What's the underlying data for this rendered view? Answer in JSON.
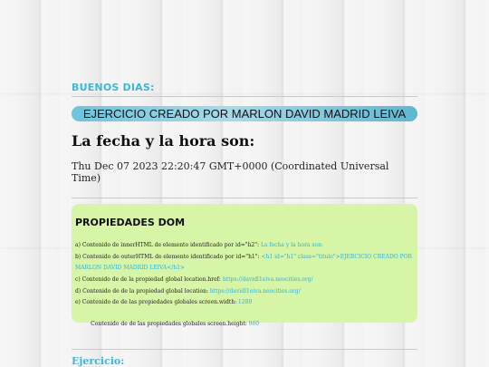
{
  "greeting": "BUENOS DIAS:",
  "banner_title": "EJERCICIO CREADO POR MARLON DAVID MADRID LEIVA",
  "heading": "La fecha y la hora son:",
  "datetime": "Thu Dec 07 2023 22:20:47 GMT+0000 (Coordinated Universal Time)",
  "dom": {
    "title": "PROPIEDADES DOM",
    "a_label": "a) Contenido de innerHTML de elemento identificado por id=\"h2\": ",
    "a_value": "La fecha y la hora son:",
    "b_label": "b) Contenido de outerHTML de elemento identificado por id=\"h1\": ",
    "b_value_1": "<h1 id=\"h1\" class=\"titulo\">EJERCICIO CREADO POR",
    "b_value_2": "MARLON DAVID MADRID LEIVA</h1>",
    "c_label": "c) Contenido de de la propiedad global location.href: ",
    "c_value": "https://davidl1eiva.neocities.org/",
    "d_label": "d) Contenido de de la propiedad global location: ",
    "d_value": "https://davidl1eiva.neocities.org/",
    "e_label": "e) Contenido de de las propiedades globales screen.width: ",
    "e_value": "1280",
    "f_label": "   Contenido de de las propiedades globales screen.height: ",
    "f_value": "960"
  },
  "exercise_label": "Ejercicio:"
}
